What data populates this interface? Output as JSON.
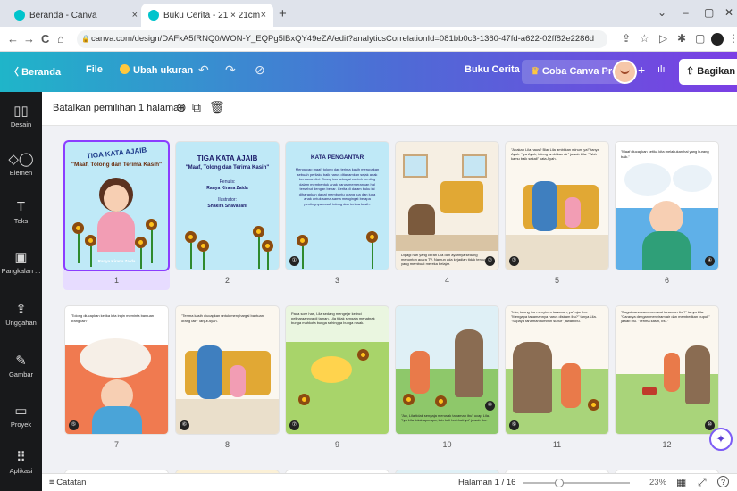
{
  "browser": {
    "tabs": [
      {
        "title": "Beranda - Canva"
      },
      {
        "title": "Buku Cerita - 21 × 21cm"
      }
    ],
    "url": "canva.com/design/DAFkA5fRNQ0/WON-Y_EQPg5lBxQY49eZA/edit?analyticsCorrelationId=081bb0c3-1360-47fd-a622-02ff82e2286d",
    "tab_close": "×",
    "new_tab": "+",
    "win_controls": [
      "⌄",
      "–",
      "▢",
      "✕"
    ],
    "nav_glyphs": {
      "back": "←",
      "forward": "→",
      "reload": "C",
      "home": "⌂"
    }
  },
  "header": {
    "back_label": "Beranda",
    "file_label": "File",
    "resize_label": "Ubah ukuran",
    "undo_glyph": "↶",
    "redo_glyph": "↷",
    "saved_glyph": "⊘",
    "doc_title": "Buku Cerita",
    "pro_label": "Coba Canva Pro",
    "plus_glyph": "+",
    "analytics_glyph": "ılı",
    "share_label": "Bagikan"
  },
  "rail": [
    {
      "label": "Desain",
      "icon": "▯▯"
    },
    {
      "label": "Elemen",
      "icon": "◇◯"
    },
    {
      "label": "Teks",
      "icon": "T"
    },
    {
      "label": "Pangkalan ...",
      "icon": "▣"
    },
    {
      "label": "Unggahan",
      "icon": "⇪"
    },
    {
      "label": "Gambar",
      "icon": "✎"
    },
    {
      "label": "Proyek",
      "icon": "▭"
    },
    {
      "label": "Aplikasi",
      "icon": "⠿"
    }
  ],
  "selection_bar": {
    "text": "Batalkan pemilihan 1 halaman",
    "icons": [
      "add-page-icon",
      "duplicate-icon",
      "trash-icon"
    ]
  },
  "pages": [
    {
      "number": "1",
      "title": "TIGA KATA AJAIB",
      "subtitle": "\"Maaf, Tolong dan Terima Kasih\"",
      "author": "Ranya Kirana Zaida"
    },
    {
      "number": "2",
      "title": "TIGA KATA AJAIB",
      "subtitle": "\"Maaf, Tolong dan Terima Kasih\"",
      "author_label": "Penulis:",
      "author": "Ranya Kirana Zaida",
      "illustrator_label": "Ilustrator:",
      "illustrator": "Shakira Shavaliani"
    },
    {
      "number": "3",
      "title": "KATA PENGANTAR",
      "body": "Mengucap maaf, tolong dan terima kasih merupakan sebuah perilaku baik harus ditanamkan sejak anak bersama dini. Orang tua sebagai contoh penting dalam membentuk anak harus memerankan hal tersebut dengan benar. Cerita di dalam buku ini diharapkan dapat membantu orang tua dan juga anak untuk sama-sama mengingat betapa pentingnya maaf, tolong dan terima kasih.",
      "badge": "①"
    },
    {
      "number": "4",
      "caption": "Dipagi hari yang cerah Lila dan ayahnya sedang menonton acara TV. Namun ada kejadian tidak terduga yang membuat mereka belajar.",
      "badge": "②"
    },
    {
      "number": "5",
      "caption": "\"Apakah Lila haus? Biar Lila ambilkan minum ya!\" tanya Ayah. \"Iya Ayah, tolong ambilkan air\" jawab Lila. \"Wah kamu baik sekali\" kata Ayah.",
      "badge": "③"
    },
    {
      "number": "6",
      "caption": "\"Maaf diucapkan ketika kita melakukan hal yang kurang baik.\"",
      "badge": "④"
    },
    {
      "number": "7",
      "caption": "\"Tolong diucapkan ketika kita ingin meminta bantuan orang lain\".",
      "badge": "⑤"
    },
    {
      "number": "8",
      "caption": "\"Terima kasih diucapkan untuk menghargai bantuan orang lain\" lanjut Ayah.",
      "badge": "⑥"
    },
    {
      "number": "9",
      "caption": "Pada sore hari, Lila sedang mengejar kelinci peliharaannya di taman. Lila tidak sengaja menabrak bunga mahkota bunga sehingga bunga rusak.",
      "badge": "⑦"
    },
    {
      "number": "10",
      "caption": "\"Aw, Lila tidak sengaja merusak tanaman ibu\" ucap Lila. \"Iya Lila tidak apa-apa, lain kali hati-hati ya\" jawab Ibu.",
      "badge": "⑧"
    },
    {
      "number": "11",
      "caption": "\"Lila, tolong ibu menyiram tanaman, ya\" ujar ibu. \"Mengapa tanamannya harus disiram ibu?\" tanya Lila. \"Supaya tanaman tumbuh subur\" jawab ibu.",
      "badge": "⑨"
    },
    {
      "number": "12",
      "caption": "\"Bagaimana cara merawat tanaman ibu?\" tanya Lila. \"Caranya dengan menyiram air dan memberikan pupuk\" jawab ibu. \"Terima kasih, Ibu.\"",
      "badge": "⑩"
    }
  ],
  "footer": {
    "notes_label": "Catatan",
    "notes_icon": "≡",
    "page_indicator": "Halaman 1 / 16",
    "zoom": "23%",
    "grid_icon": "▦",
    "expand_icon": "⤢",
    "help_icon": "?"
  },
  "magic_glyph": "✦",
  "colors": {
    "accent": "#8b3dff",
    "header_start": "#1fb5c9",
    "header_end": "#7b3fe4",
    "rail": "#18191b"
  }
}
